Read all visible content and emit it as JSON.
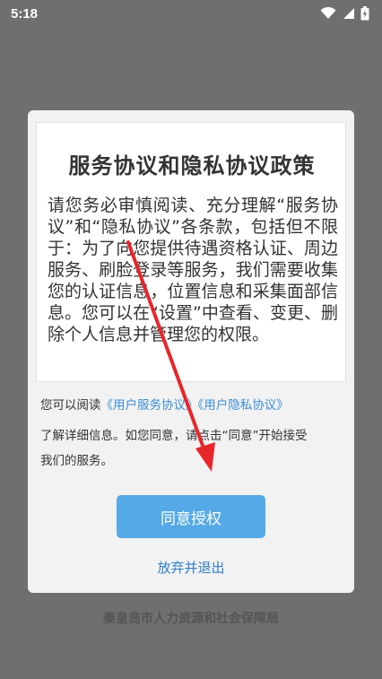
{
  "status_bar": {
    "time": "5:18"
  },
  "dialog": {
    "title": "服务协议和隐私协议政策",
    "body": "请您务必审慎阅读、充分理解“服务协议”和“隐私协议”各条款，包括但不限于：为了向您提供待遇资格认证、周边服务、刷脸登录等服务，我们需要收集您的认证信息，位置信息和采集面部信息。您可以在“设置”中查看、变更、删除个人信息并管理您的权限。",
    "note_prefix": "您可以阅读",
    "user_agreement_link": "《用户服务协议》",
    "privacy_link": "《用户隐私协议》",
    "note_line2": "了解详细信息。如您同意，请点击“同意”开始接受",
    "note_line3": "我们的服务。",
    "agree_label": "同意授权",
    "quit_label": "放弃并退出"
  },
  "footer": {
    "org": "秦皇岛市人力资源和社会保障局"
  },
  "colors": {
    "accent": "#55a9e6",
    "link": "#3a8fd6",
    "arrow": "#e8262a"
  }
}
